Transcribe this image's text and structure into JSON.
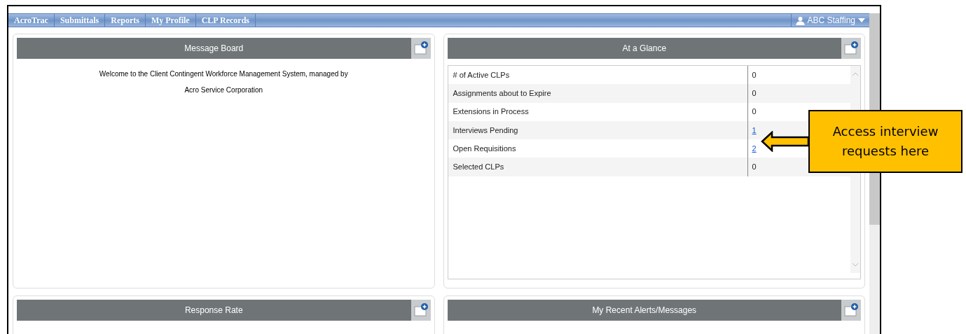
{
  "nav": {
    "items": [
      "AcroTrac",
      "Submittals",
      "Reports",
      "My Profile",
      "CLP Records"
    ],
    "user": "ABC Staffing"
  },
  "panels": [
    {
      "title": "Message Board",
      "kind": "message",
      "lines": [
        "Welcome to the Client Contingent Workforce Management System, managed by",
        "Acro Service Corporation"
      ]
    },
    {
      "title": "At a Glance",
      "kind": "glance",
      "rows": [
        {
          "label": "# of Active CLPs",
          "value": "0",
          "kind": "text"
        },
        {
          "label": "Assignments about to Expire",
          "value": "0",
          "kind": "text"
        },
        {
          "label": "Extensions in Process",
          "value": "0",
          "kind": "text"
        },
        {
          "label": "Interviews Pending",
          "value": "1",
          "kind": "link"
        },
        {
          "label": "Open Requisitions",
          "value": "2",
          "kind": "link"
        },
        {
          "label": "Selected CLPs",
          "value": "0",
          "kind": "text"
        }
      ]
    },
    {
      "title": "Response Rate",
      "kind": "empty"
    },
    {
      "title": "My Recent Alerts/Messages",
      "kind": "empty"
    }
  ],
  "callout": "Access interview requests here"
}
